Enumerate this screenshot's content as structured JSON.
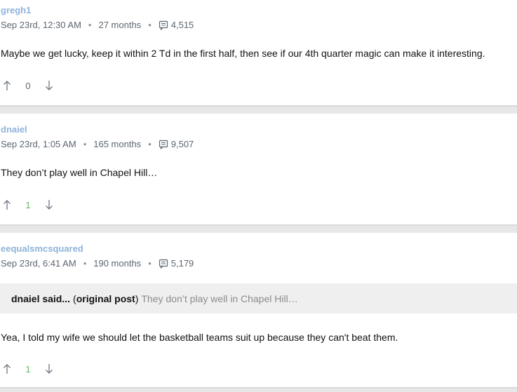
{
  "posts": [
    {
      "username": "gregh1",
      "date": "Sep 23rd, 12:30 AM",
      "tenure": "27 months",
      "post_count": "4,515",
      "body": "Maybe we get lucky, keep it within 2 Td in the first half, then see if our 4th quarter magic can make it interesting.",
      "score": "0"
    },
    {
      "username": "dnaiel",
      "date": "Sep 23rd, 1:05 AM",
      "tenure": "165 months",
      "post_count": "9,507",
      "body": "They don’t play well in Chapel Hill…",
      "score": "1"
    },
    {
      "username": "eequalsmcsquared",
      "date": "Sep 23rd, 6:41 AM",
      "tenure": "190 months",
      "post_count": "5,179",
      "quote": {
        "user": "dnaiel said...",
        "open_paren": "(",
        "link": "original post",
        "close_paren": ")",
        "text": "They don’t play well in Chapel Hill…"
      },
      "body": "Yea, I told my wife we should let the basketball teams suit up because they can't beat them.",
      "score": "1"
    }
  ],
  "meta_separator": "•",
  "icons": {
    "post_count": "comment-icon",
    "upvote": "arrow-up-icon",
    "downvote": "arrow-down-icon"
  },
  "colors": {
    "username": "#8fb3d9",
    "score_positive": "#5cb85c",
    "quote_bg": "#efefef",
    "separator": "#e7e7e7"
  }
}
